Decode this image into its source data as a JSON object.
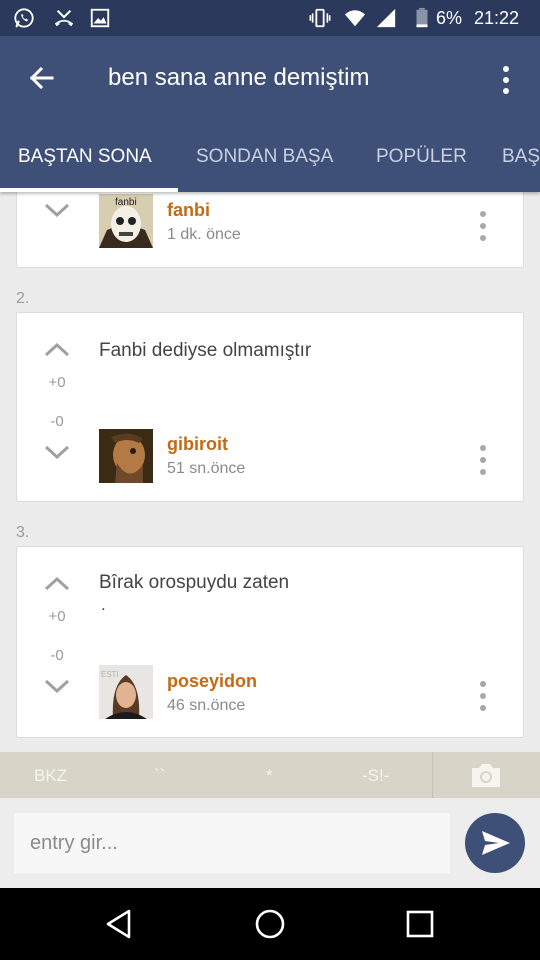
{
  "status_bar": {
    "battery": "6%",
    "time": "21:22",
    "icons": [
      "whatsapp-icon",
      "missed-call-icon",
      "gallery-icon",
      "vibrate-icon",
      "wifi-icon",
      "signal-icon",
      "battery-icon"
    ]
  },
  "toolbar": {
    "title": "ben sana anne demiştim",
    "back_icon": "arrow-back-icon",
    "menu_icon": "more-vert-icon"
  },
  "tabs": [
    {
      "label": "BAŞTAN SONA",
      "active": true
    },
    {
      "label": "SONDAN BAŞA",
      "active": false
    },
    {
      "label": "POPÜLER",
      "active": false
    },
    {
      "label": "BAŞ",
      "active": false
    }
  ],
  "entries": [
    {
      "author": "fanbi",
      "time": "1 dk. önce",
      "avatar_label": "fanbi"
    },
    {
      "number": "2.",
      "text": "Fanbi dediyse olmamıştır",
      "up_count": "+0",
      "down_count": "-0",
      "author": "gibiroit",
      "time": "51 sn.önce"
    },
    {
      "number": "3.",
      "text": "Bîrak orospuydu zaten",
      "text2": ".",
      "up_count": "+0",
      "down_count": "-0",
      "author": "poseyidon",
      "time": "46 sn.önce"
    }
  ],
  "bbcode_bar": {
    "buttons": [
      "BKZ",
      "``",
      "*",
      "-S!-"
    ],
    "camera_icon": "camera-icon"
  },
  "composer": {
    "placeholder": "entry gir...",
    "send_icon": "send-icon"
  },
  "colors": {
    "primary": "#3e4f78",
    "status_bar": "#2b3a5c",
    "author": "#c46a14"
  }
}
